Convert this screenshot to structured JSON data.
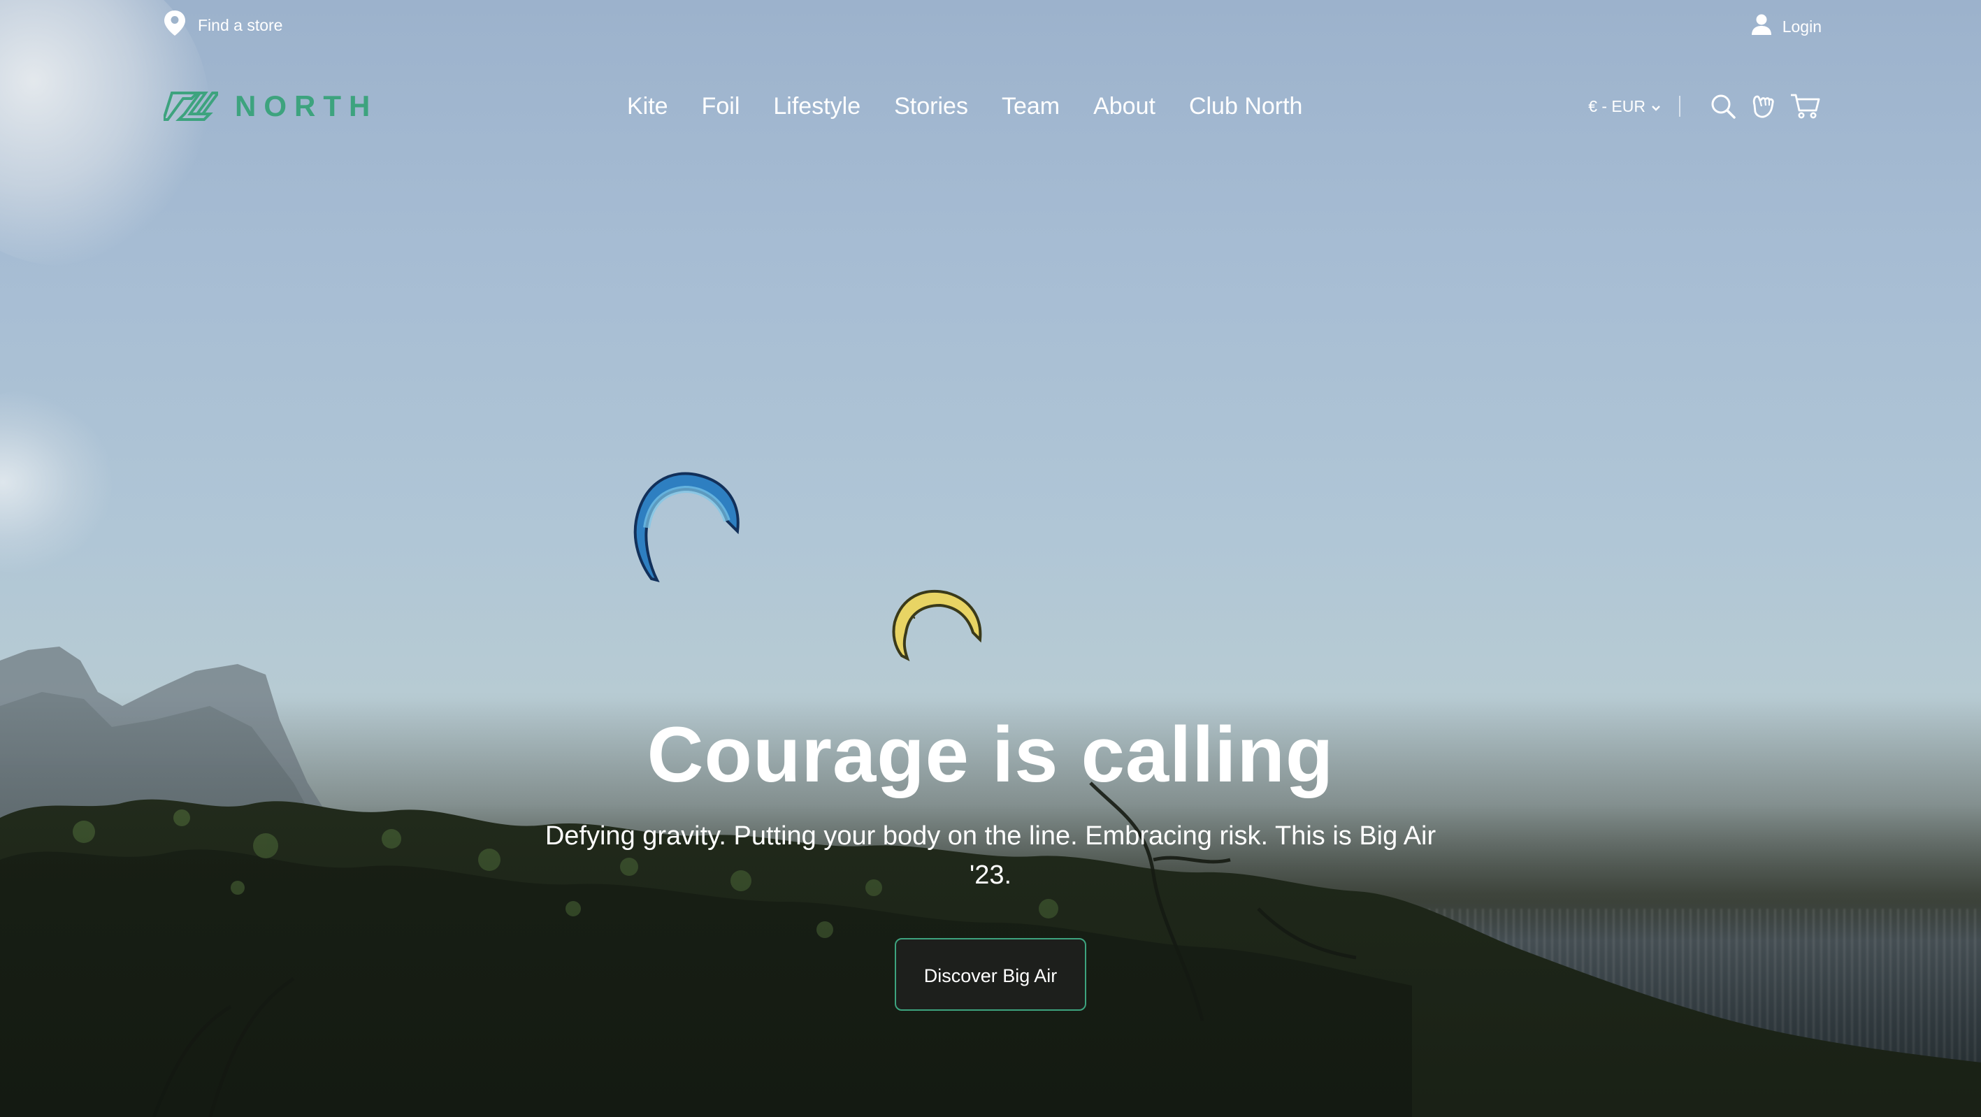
{
  "topbar": {
    "store_label": "Find a store",
    "store_icon": "map-pin-icon",
    "login_label": "Login",
    "login_icon": "user-icon"
  },
  "nav": {
    "brand": "NORTH",
    "items": [
      {
        "label": "Kite"
      },
      {
        "label": "Foil"
      },
      {
        "label": "Lifestyle"
      },
      {
        "label": "Stories"
      },
      {
        "label": "Team"
      },
      {
        "label": "About"
      },
      {
        "label": "Club North"
      }
    ],
    "currency": "€ - EUR",
    "icons": [
      "search-icon",
      "shaka-hand-icon",
      "cart-icon"
    ]
  },
  "hero": {
    "title": "Courage is calling",
    "subtitle": "Defying gravity. Putting your body on the line. Embracing risk. This is Big Air '23.",
    "cta_label": "Discover Big Air"
  },
  "colors": {
    "brand_green": "#3da37e",
    "button_bg": "#1d1f1c",
    "text": "#ffffff"
  }
}
